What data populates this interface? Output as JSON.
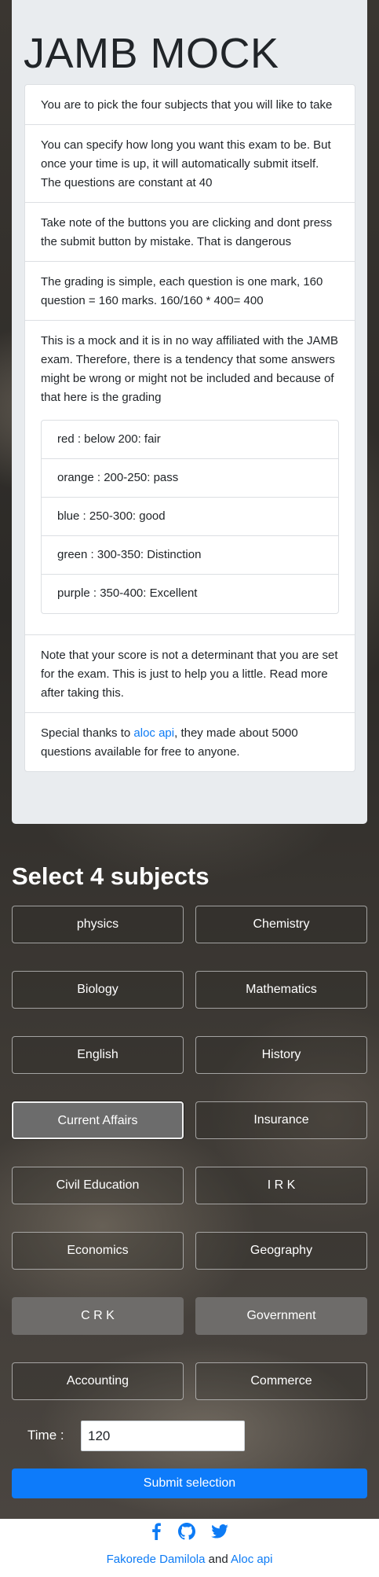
{
  "intro": {
    "title": "JAMB MOCK",
    "items": [
      "You are to pick the four subjects that you will like to take",
      "You can specify how long you want this exam to be. But once your time is up, it will automatically submit itself. The questions are constant at 40",
      "Take note of the buttons you are clicking and dont press the submit button by mistake. That is dangerous",
      "The grading is simple, each question is one mark, 160 question = 160 marks. 160/160 * 400= 400",
      "This is a mock and it is in no way affiliated with the JAMB exam. Therefore, there is a tendency that some answers might be wrong or might not be included and because of that here is the grading"
    ],
    "grades": [
      "red : below 200: fair",
      "orange : 200-250: pass",
      "blue : 250-300: good",
      "green : 300-350: Distinction",
      "purple : 350-400: Excellent"
    ],
    "note": "Note that your score is not a determinant that you are set for the exam. This is just to help you a little. Read more after taking this.",
    "thanks_prefix": "Special thanks to ",
    "thanks_link": "aloc api",
    "thanks_suffix": ", they made about 5000 questions available for free to anyone."
  },
  "select": {
    "heading": "Select 4 subjects",
    "subjects": [
      "physics",
      "Chemistry",
      "Biology",
      "Mathematics",
      "English",
      "History",
      "Current Affairs",
      "Insurance",
      "Civil Education",
      "I R K",
      "Economics",
      "Geography",
      "C R K",
      "Government",
      "Accounting",
      "Commerce"
    ]
  },
  "form": {
    "time_label": "Time :",
    "time_value": "120",
    "submit_label": "Submit selection"
  },
  "footer": {
    "author": "Fakorede Damilola",
    "and": " and ",
    "api": "Aloc api"
  },
  "colors": {
    "link": "#0d7bf5",
    "submit": "#0d7bfa",
    "jumbotron": "#e9ecef"
  },
  "icons": [
    "facebook-icon",
    "github-icon",
    "twitter-icon"
  ]
}
